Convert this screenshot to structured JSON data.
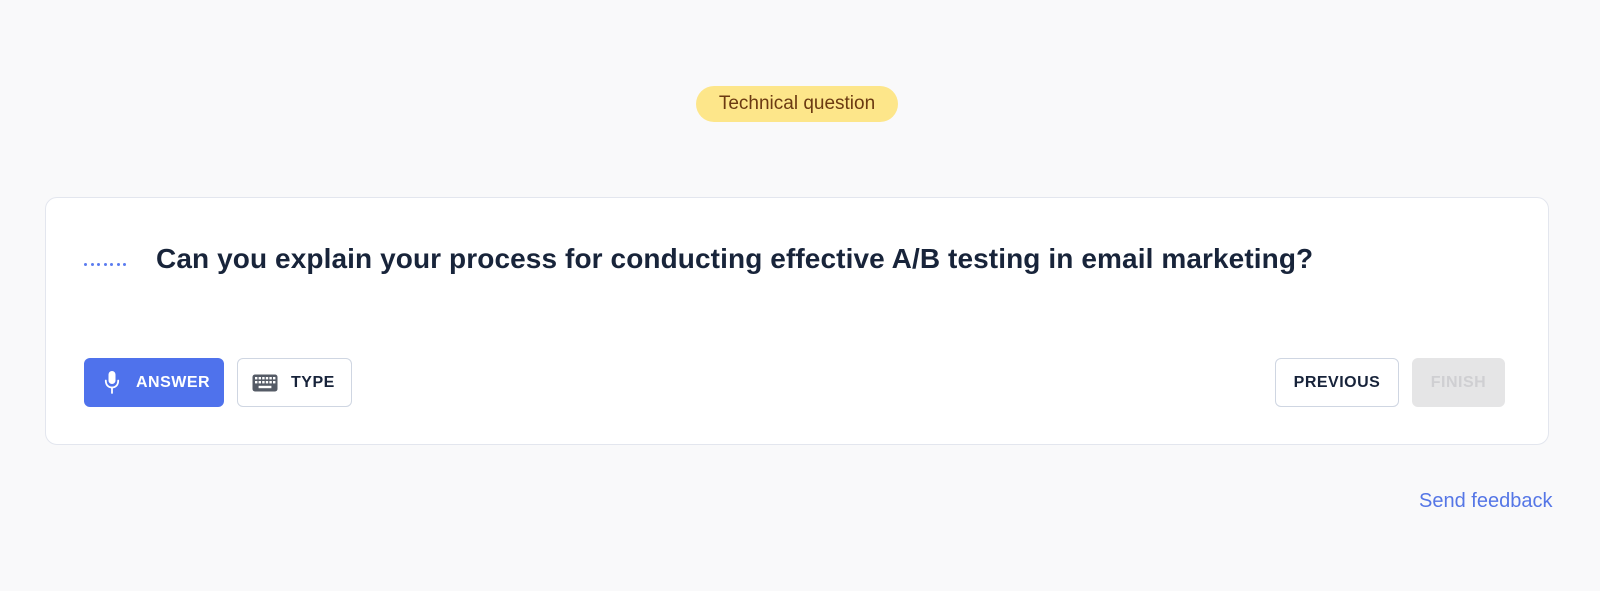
{
  "badge": {
    "label": "Technical question",
    "bg_color": "#fde68a",
    "text_color": "#6b3a12"
  },
  "question": {
    "text": "Can you explain your process for conducting effective A/B testing in email marketing?",
    "indicator_icon": "dotted-line-icon"
  },
  "actions": {
    "answer": {
      "label": "ANSWER",
      "icon": "microphone-icon",
      "bg_color": "#4f72ec"
    },
    "type": {
      "label": "TYPE",
      "icon": "keyboard-icon"
    },
    "previous": {
      "label": "PREVIOUS"
    },
    "finish": {
      "label": "FINISH",
      "disabled": true
    }
  },
  "footer": {
    "feedback_link": "Send feedback",
    "link_color": "#5576e6"
  }
}
